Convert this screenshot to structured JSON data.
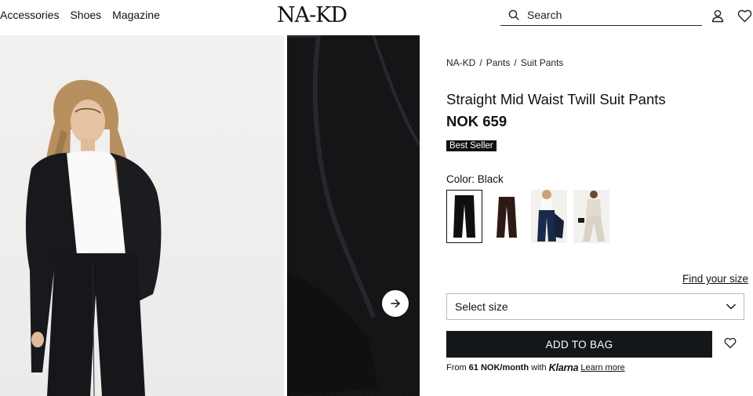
{
  "header": {
    "nav": [
      "Accessories",
      "Shoes",
      "Magazine"
    ],
    "logo": "NA-KD",
    "search_label": "Search"
  },
  "gallery": {
    "next_arrow_icon": "arrow-right-icon"
  },
  "product": {
    "breadcrumb": [
      "NA-KD",
      "Pants",
      "Suit Pants"
    ],
    "breadcrumb_sep": "/",
    "title": "Straight Mid Waist Twill Suit Pants",
    "price": "NOK 659",
    "badge": "Best Seller",
    "color_label": "Color: Black",
    "swatches": [
      {
        "name": "black",
        "selected": true,
        "color": "#0f0f12"
      },
      {
        "name": "brown",
        "selected": false,
        "color": "#2e1a14"
      },
      {
        "name": "navy",
        "selected": false,
        "color": "#1a2a4a"
      },
      {
        "name": "beige",
        "selected": false,
        "color": "#d9d2c5"
      }
    ],
    "find_size": "Find your size",
    "select_size": "Select size",
    "add_to_bag": "ADD TO BAG",
    "klarna": {
      "prefix": "From",
      "amount": "61 NOK/month",
      "mid": "with",
      "brand": "Klarna",
      "learn_more": "Learn more"
    }
  },
  "colors": {
    "button_bg": "#141719",
    "text": "#111111"
  }
}
